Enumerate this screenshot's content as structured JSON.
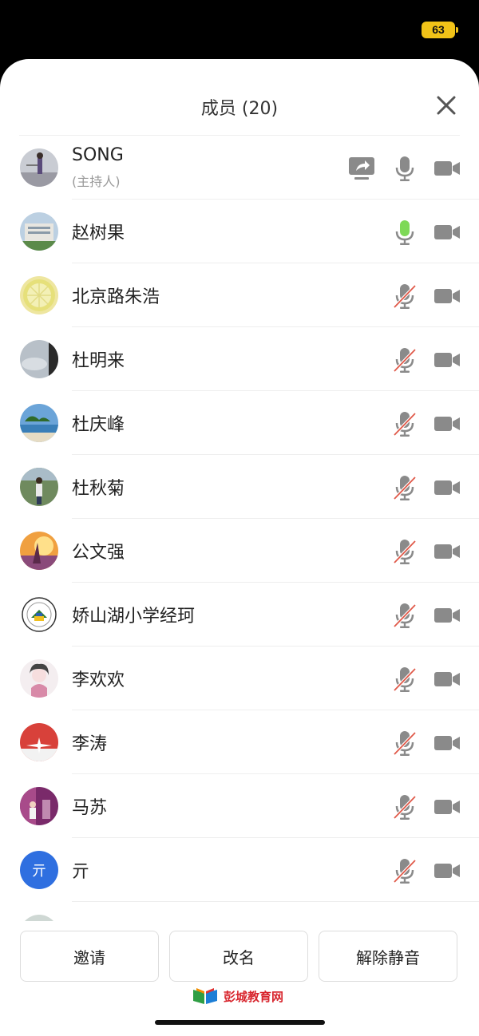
{
  "status": {
    "battery": "63"
  },
  "header": {
    "title": "成员 (20)"
  },
  "members": [
    {
      "name": "SONG",
      "role": "(主持人)",
      "mic": "host",
      "share": true
    },
    {
      "name": "赵树果",
      "mic": "active"
    },
    {
      "name": "北京路朱浩",
      "mic": "muted"
    },
    {
      "name": "杜明来",
      "mic": "muted"
    },
    {
      "name": "杜庆峰",
      "mic": "muted"
    },
    {
      "name": "杜秋菊",
      "mic": "muted"
    },
    {
      "name": "公文强",
      "mic": "muted"
    },
    {
      "name": "娇山湖小学经珂",
      "mic": "muted"
    },
    {
      "name": "李欢欢",
      "mic": "muted"
    },
    {
      "name": "李涛",
      "mic": "muted"
    },
    {
      "name": "马苏",
      "mic": "muted"
    },
    {
      "name": "亓",
      "avatar_text": "亓",
      "mic": "muted"
    }
  ],
  "footer": {
    "invite_label": "邀请",
    "rename_label": "改名",
    "unmute_label": "解除静音",
    "watermark": "彭城教育网"
  },
  "colors": {
    "mic_active": "#7ed957",
    "mute_slash": "#e05a4a",
    "icon_gray": "#8a8a8a"
  }
}
